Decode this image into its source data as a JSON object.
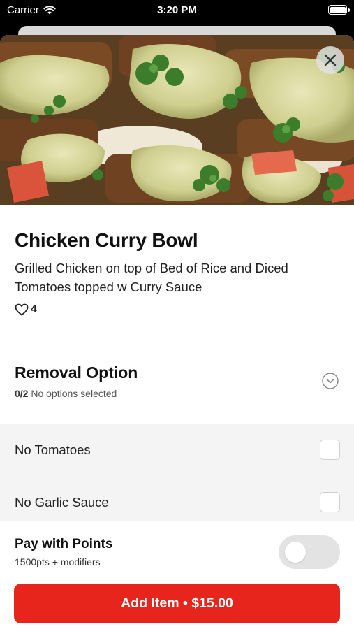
{
  "status_bar": {
    "carrier": "Carrier",
    "time": "3:20 PM",
    "icons": [
      "wifi-icon",
      "battery-icon"
    ]
  },
  "item": {
    "title": "Chicken Curry Bowl",
    "description": "Grilled Chicken on top of Bed of Rice and Diced Tomatoes topped w Curry Sauce",
    "likes": "4",
    "image_alt": "food-photo"
  },
  "removal_option": {
    "title": "Removal Option",
    "count": "0/2",
    "status": "No options selected",
    "options": [
      {
        "label": "No Tomatoes",
        "checked": false
      },
      {
        "label": "No Garlic Sauce",
        "checked": false
      }
    ]
  },
  "points": {
    "title": "Pay with Points",
    "subtitle": "1500pts + modifiers",
    "enabled": false
  },
  "add_button": {
    "label": "Add Item • $15.00"
  },
  "colors": {
    "accent": "#e8251c",
    "toggle_off": "#e3e3e3",
    "list_bg": "#f4f4f4"
  }
}
